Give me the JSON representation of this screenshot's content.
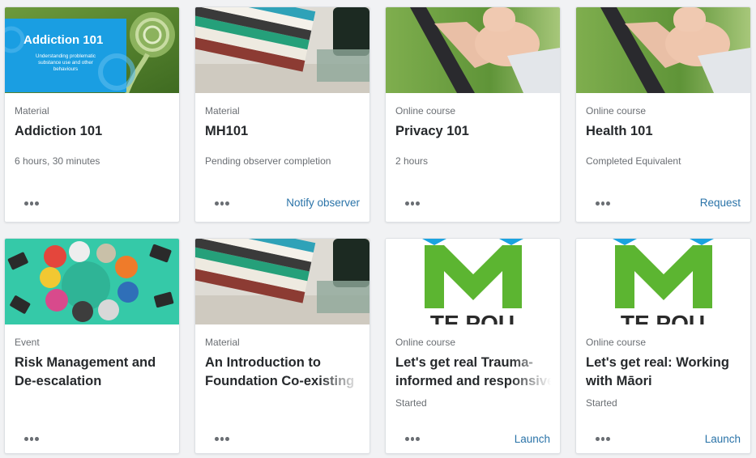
{
  "cards": [
    {
      "type": "Material",
      "title": "Addiction 101",
      "meta": "6 hours, 30 minutes",
      "action": "",
      "thumb": {
        "heading": "Addiction 101",
        "subtitle_line1": "Understanding problematic",
        "subtitle_line2": "substance use and other",
        "subtitle_line3": "behaviours",
        "accent": "#1a9ee2"
      }
    },
    {
      "type": "Material",
      "title": "MH101",
      "meta": "Pending observer completion",
      "action": "Notify observer"
    },
    {
      "type": "Online course",
      "title": "Privacy 101",
      "meta": "2 hours",
      "action": ""
    },
    {
      "type": "Online course",
      "title": "Health 101",
      "meta": "Completed Equivalent",
      "action": "Request"
    },
    {
      "type": "Event",
      "title_line1": "Risk Management and",
      "title_line2": "De-escalation",
      "meta": "",
      "action": ""
    },
    {
      "type": "Material",
      "title_line1": "An Introduction to",
      "title_line2": "Foundation Co-existing",
      "meta": "",
      "action": ""
    },
    {
      "type": "Online course",
      "title_line1": "Let's get real Trauma-",
      "title_line2": "informed and responsive",
      "meta": "Started",
      "action": "Launch",
      "thumb": {
        "logo_text": "TE POU"
      }
    },
    {
      "type": "Online course",
      "title_line1": "Let's get real: Working",
      "title_line2": "with Māori",
      "meta": "Started",
      "action": "Launch",
      "thumb": {
        "logo_text": "TE POU"
      }
    }
  ],
  "colors": {
    "link": "#2a73a8",
    "teal_bg": "#35c9a8",
    "logo_green": "#5cb531",
    "logo_blue": "#1aa3e0"
  }
}
